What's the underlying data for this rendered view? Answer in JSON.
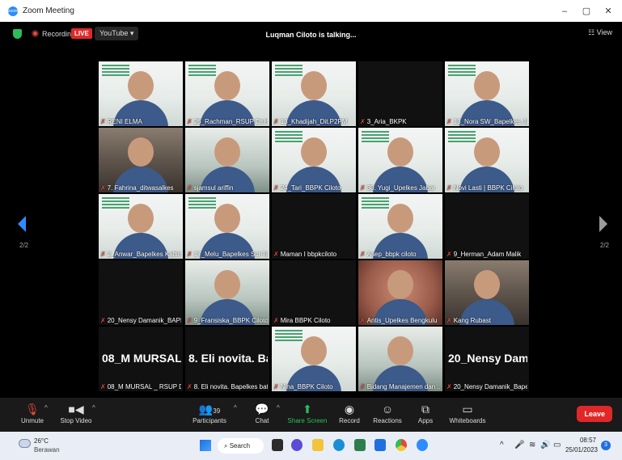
{
  "window": {
    "title": "Zoom Meeting",
    "minimize": "–",
    "restore": "▢",
    "close": "✕"
  },
  "topbar": {
    "recording_label": "Recording",
    "live_badge": "LIVE",
    "stream_target": "YouTube ▾",
    "speaker_status": "Luqman Ciloto is talking...",
    "view_label": "☷ View"
  },
  "pager": {
    "left": "2/2",
    "right": "2/2"
  },
  "participants": [
    {
      "name": "RENI ELMA",
      "bg": "banner"
    },
    {
      "name": "26_Rachman_RSUP Dr.Ha...",
      "bg": "banner"
    },
    {
      "name": "13_Khadijah_Dit.P2PM",
      "bg": "banner"
    },
    {
      "name": "3_Aria_BKPK",
      "bg": "dark"
    },
    {
      "name": "13_Nora SW_Bapelkes Jat...",
      "bg": "banner"
    },
    {
      "name": "7. Fahrina_ditwasalkes",
      "bg": "room"
    },
    {
      "name": "sjamsul ariffin",
      "bg": "office"
    },
    {
      "name": "24_Tari_BBPK Ciloto",
      "bg": "banner"
    },
    {
      "name": "30. Yugi_Upelkes Jabar",
      "bg": "banner"
    },
    {
      "name": "Novi Lasti | BBPK Ciloto",
      "bg": "banner"
    },
    {
      "name": "2_Anwar_Bapelkes Kaltim",
      "bg": "banner"
    },
    {
      "name": "17_Melu_Bapelkes Sul-Te...",
      "bg": "banner"
    },
    {
      "name": "Maman I bbpkciloto",
      "bg": "dark"
    },
    {
      "name": "Asep_bbpk ciloto",
      "bg": "banner"
    },
    {
      "name": "9_Herman_Adam Malik",
      "bg": "dark"
    },
    {
      "name": "20_Nensy Damanik_BAPE...",
      "bg": "dark"
    },
    {
      "name": "9_Fransiska_BBPK Ciloto",
      "bg": "office"
    },
    {
      "name": "Mira BBPK Ciloto",
      "bg": "dark"
    },
    {
      "name": "Antis_Upelkes Bengkulu",
      "bg": "skin"
    },
    {
      "name": "Kang Rubast",
      "bg": "room"
    },
    {
      "name": "08_M MURSAL _ RSUP Dr ...",
      "bg": "dark",
      "big": "08_M MURSAL..."
    },
    {
      "name": "8. Eli novita. Bapelkes bat...",
      "bg": "dark",
      "big": "8. Eli novita. Ba..."
    },
    {
      "name": "Nina_BBPK Ciloto",
      "bg": "banner"
    },
    {
      "name": "Bidang Manajemen dan ...",
      "bg": "office"
    },
    {
      "name": "20_Nensy Damanik_Bapel...",
      "bg": "dark",
      "big": "20_Nensy Dama..."
    }
  ],
  "toolbar": {
    "unmute": "Unmute",
    "stop_video": "Stop Video",
    "participants": "Participants",
    "participants_count": "39",
    "chat": "Chat",
    "share_screen": "Share Screen",
    "record": "Record",
    "reactions": "Reactions",
    "apps": "Apps",
    "whiteboards": "Whiteboards",
    "leave": "Leave"
  },
  "taskbar": {
    "temperature": "26°C",
    "weather": "Berawan",
    "search": "Search",
    "time": "08:57",
    "date": "25/01/2023",
    "notifications": "3"
  },
  "colors": {
    "accent": "#2d8cff",
    "leave": "#e02828",
    "share": "#2bbf5a"
  }
}
